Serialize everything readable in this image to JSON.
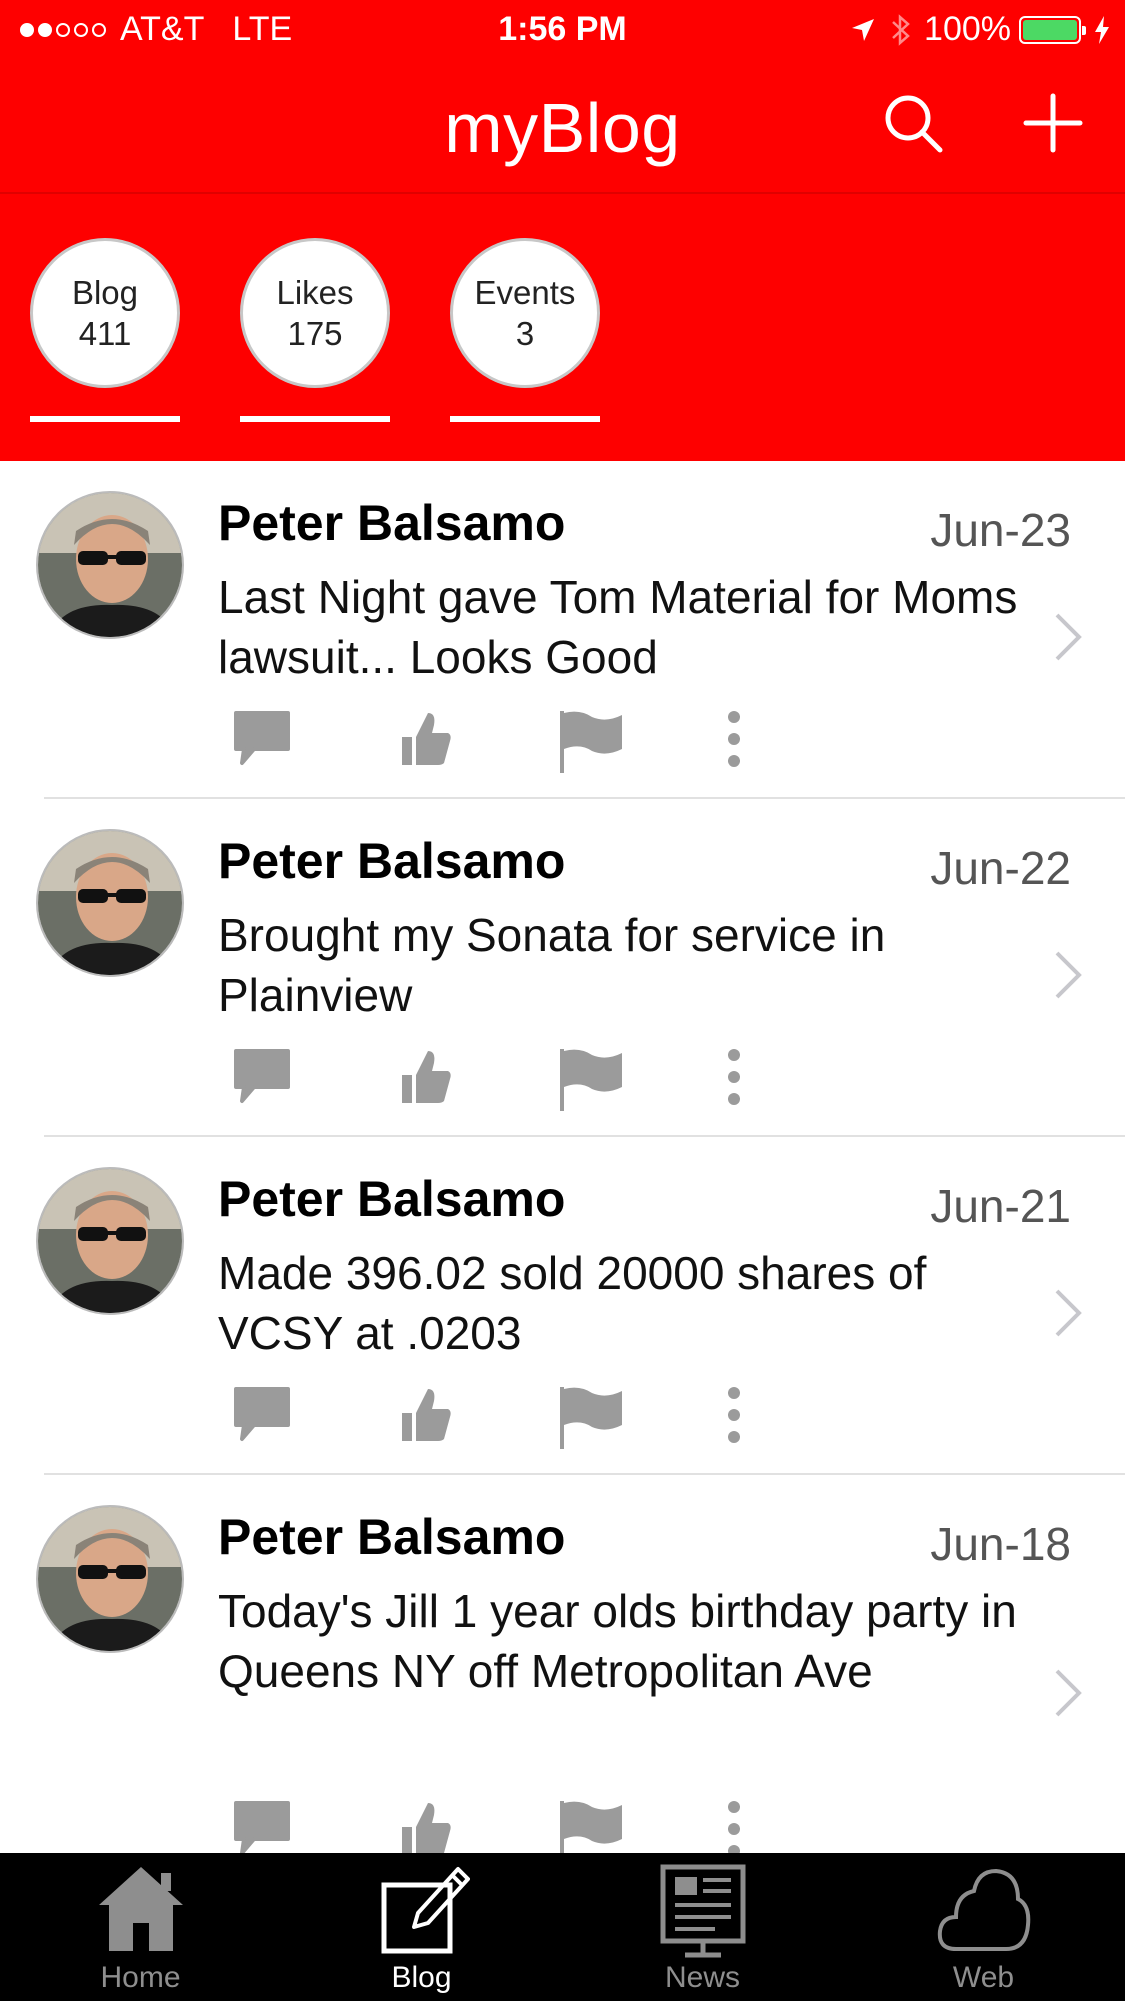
{
  "status_bar": {
    "carrier": "AT&T",
    "network": "LTE",
    "time": "1:56 PM",
    "battery": "100%",
    "signal_bars_filled": 2,
    "signal_bars_total": 5,
    "battery_color": "#4cd964"
  },
  "nav": {
    "title": "myBlog",
    "search_icon": "search-icon",
    "add_icon": "plus-icon"
  },
  "stats": [
    {
      "label": "Blog",
      "value": "411"
    },
    {
      "label": "Likes",
      "value": "175"
    },
    {
      "label": "Events",
      "value": "3"
    }
  ],
  "posts": [
    {
      "author": "Peter Balsamo",
      "date": "Jun-23",
      "text": "Last Night gave Tom Material for Moms lawsuit... Looks Good"
    },
    {
      "author": "Peter Balsamo",
      "date": "Jun-22",
      "text": "Brought my Sonata for service in Plainview"
    },
    {
      "author": "Peter Balsamo",
      "date": "Jun-21",
      "text": "Made 396.02 sold 20000 shares of VCSY at .0203"
    },
    {
      "author": "Peter Balsamo",
      "date": "Jun-18",
      "text": "Today's Jill 1 year olds birthday party in Queens NY off Metropolitan Ave"
    }
  ],
  "post_actions": [
    "comment-icon",
    "thumbs-up-icon",
    "flag-icon",
    "more-vertical-icon"
  ],
  "tabs": [
    {
      "label": "Home",
      "icon": "home-icon",
      "active": false
    },
    {
      "label": "Blog",
      "icon": "blog-edit-icon",
      "active": true
    },
    {
      "label": "News",
      "icon": "news-icon",
      "active": false
    },
    {
      "label": "Web",
      "icon": "cloud-icon",
      "active": false
    }
  ],
  "colors": {
    "header_red": "#fe0000",
    "tabbar_bg": "#000000",
    "action_icon_gray": "#9b9b9b",
    "chevron_gray": "#c7c7cc",
    "tab_inactive": "#8e8e8e",
    "tab_active": "#ffffff"
  }
}
